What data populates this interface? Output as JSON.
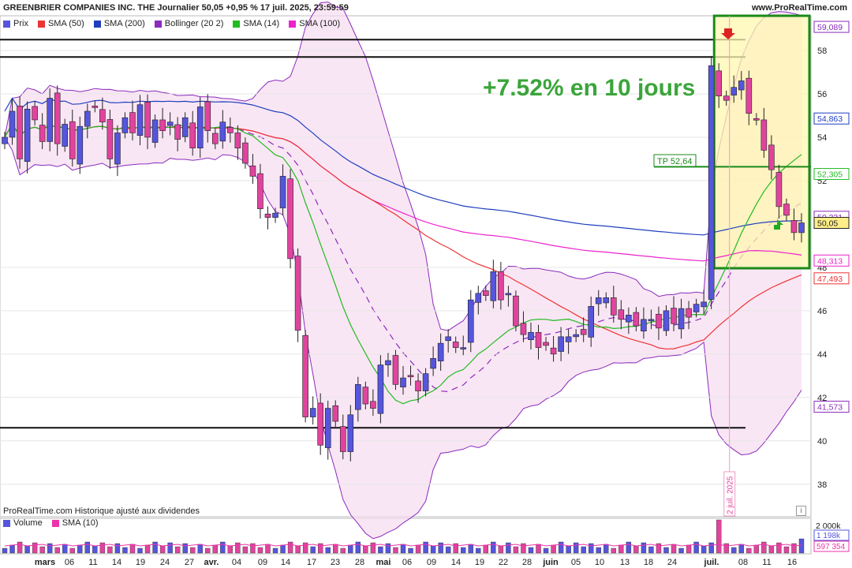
{
  "header": {
    "title": "GREENBRIER COMPANIES INC. THE Journalier 50,05 +0,95 % 17 juil. 2025, 23:59:59",
    "site": "www.ProRealTime.com"
  },
  "legend": [
    {
      "label": "Prix",
      "color": "#5555dd"
    },
    {
      "label": "SMA (50)",
      "color": "#ee3333"
    },
    {
      "label": "SMA (200)",
      "color": "#1f3fbf"
    },
    {
      "label": "Bollinger (20 2)",
      "color": "#8a2bbd"
    },
    {
      "label": "SMA (14)",
      "color": "#22bb22"
    },
    {
      "label": "SMA (100)",
      "color": "#ee22cc"
    }
  ],
  "volume_legend": [
    {
      "label": "Volume",
      "color": "#5555dd"
    },
    {
      "label": "SMA (10)",
      "color": "#ee33aa"
    }
  ],
  "source_note": "ProRealTime.com  Historique ajusté aux dividendes",
  "annotation": "+7.52% en 10 jours",
  "tp_label": "TP 52,64",
  "date_marker": "2 juil. 2025",
  "price_axis": {
    "ticks": [
      "38",
      "40",
      "42",
      "44",
      "46",
      "48",
      "52",
      "54",
      "56",
      "58"
    ],
    "boxes": [
      {
        "label": "59,089",
        "color": "#8a2bbd",
        "value": 59.089
      },
      {
        "label": "54,863",
        "color": "#1f3fbf",
        "value": 54.863
      },
      {
        "label": "52,305",
        "color": "#22bb22",
        "value": 52.305
      },
      {
        "label": "50,331",
        "color": "#8a2bbd",
        "value": 50.331
      },
      {
        "label": "50,05",
        "color": "#222222",
        "value": 50.05
      },
      {
        "label": "48,313",
        "color": "#ee22cc",
        "value": 48.313
      },
      {
        "label": "47,493",
        "color": "#ee3333",
        "value": 47.493
      },
      {
        "label": "41,573",
        "color": "#8a2bbd",
        "value": 41.573
      }
    ]
  },
  "volume_axis": {
    "ticks": [
      "2 000k"
    ],
    "boxes": [
      {
        "label": "1 198k",
        "color": "#5555dd"
      },
      {
        "label": "597 354",
        "color": "#ee33aa"
      }
    ]
  },
  "chart_data": {
    "type": "candlestick",
    "title": "GREENBRIER COMPANIES INC. THE Journalier 50,05 +0,95 % 17 juil. 2025, 23:59:59",
    "ylim": [
      36.5,
      59.6
    ],
    "x_tick_labels": [
      "mars",
      "06",
      "11",
      "14",
      "19",
      "24",
      "27",
      "avr.",
      "04",
      "09",
      "14",
      "17",
      "23",
      "28",
      "mai",
      "06",
      "09",
      "14",
      "19",
      "22",
      "28",
      "juin",
      "05",
      "10",
      "13",
      "18",
      "24",
      "juil.",
      "08",
      "11",
      "16"
    ],
    "horizontal_lines": [
      58.5,
      57.7,
      40.6
    ],
    "tp_level": 52.64,
    "close_series": [
      54,
      55.2,
      53,
      55.3,
      54.8,
      53.8,
      55.8,
      53.7,
      54.6,
      53,
      54.5,
      55.2,
      55.4,
      54.7,
      53,
      54.2,
      54.9,
      54.2,
      55.5,
      54,
      54.8,
      54.3,
      54.7,
      53.9,
      54.9,
      53.5,
      55.4,
      54.3,
      53.7,
      54.7,
      54.2,
      53.5,
      52.8,
      52.2,
      50.7,
      50.3,
      50.5,
      52.2,
      48.4,
      45.1,
      41.1,
      41.5,
      39.8,
      41.5,
      40.9,
      39.5,
      41.2,
      42.6,
      41.7,
      41.5,
      43.5,
      43.7,
      42.6,
      42.9,
      43,
      42.3,
      43.1,
      43.8,
      44.5,
      44.8,
      44.3,
      44.3,
      46.5,
      46.8,
      46.7,
      47.8,
      46.5,
      46.8,
      45.3,
      44.9,
      45,
      44.3,
      44.4,
      44,
      44.8,
      44.8,
      44.9,
      44.9,
      46.2,
      46.6,
      46.6,
      45.8,
      45.6,
      45.8,
      45.3,
      45.6,
      45.6,
      45.2,
      46,
      45.4,
      46.1,
      45.7,
      46.3,
      46.4,
      57.3,
      55.9,
      55.7,
      56.3,
      56.6,
      55.1,
      54.8,
      53.4,
      52.5,
      50.8,
      50.4,
      49.6,
      50.05
    ],
    "candles_visible": 106,
    "volume_sma_last": 597354,
    "volume_last": 1198000
  }
}
